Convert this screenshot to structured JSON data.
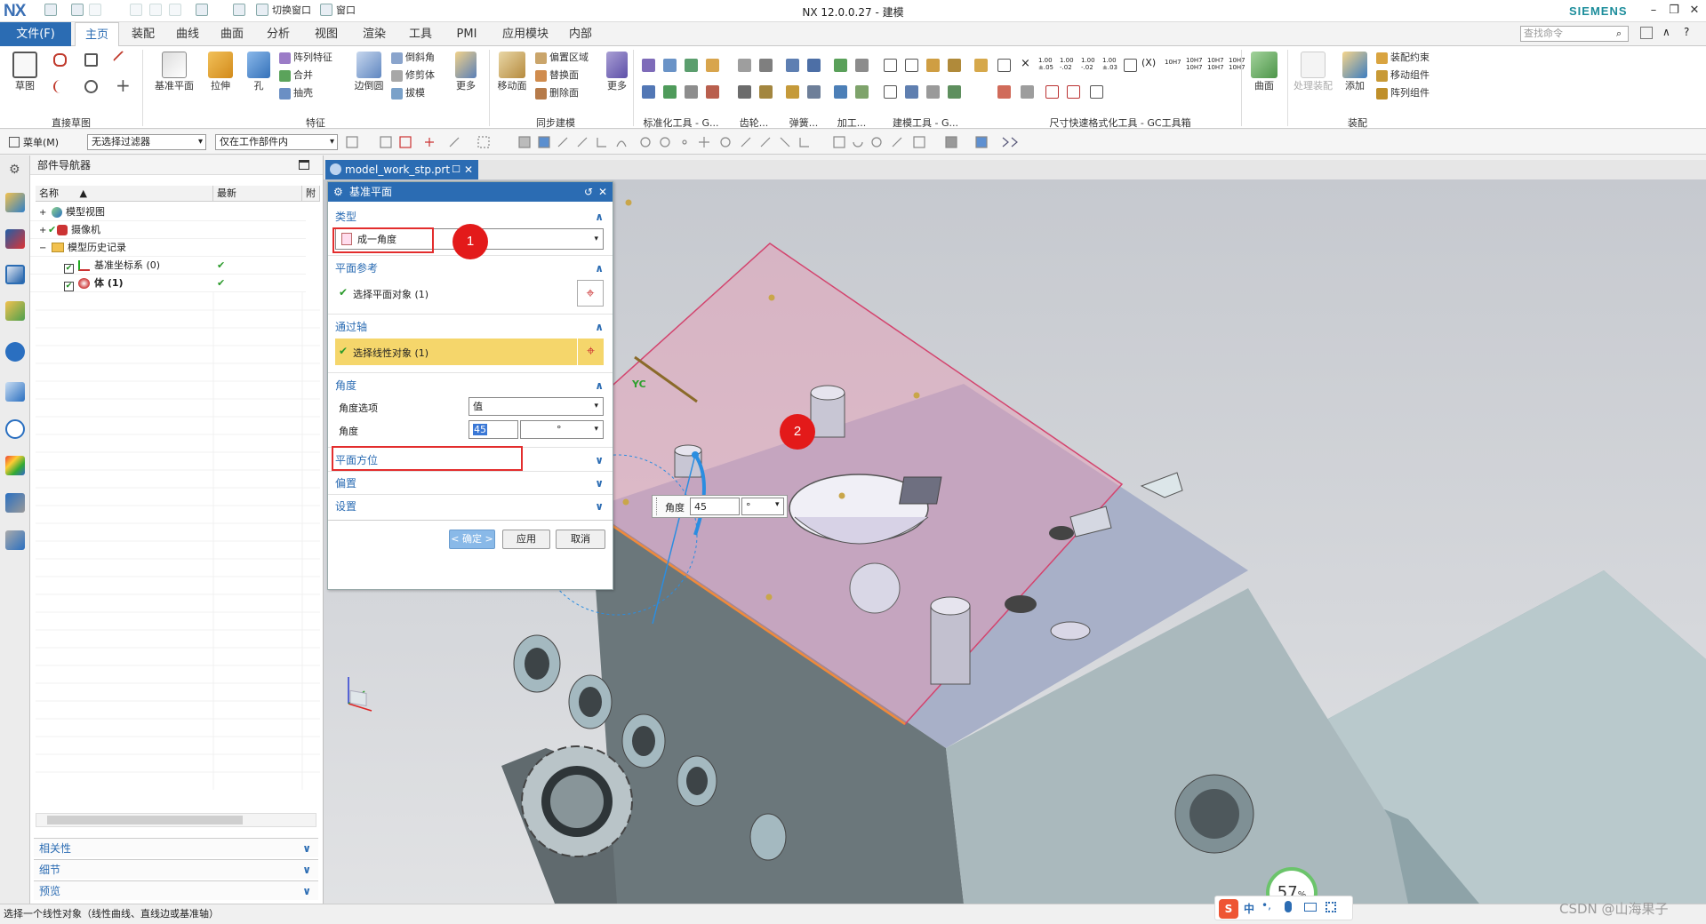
{
  "window": {
    "logo": "NX",
    "title": "NX 12.0.0.27 - 建模",
    "brand": "SIEMENS",
    "quick_access": {
      "switch_window": "切换窗口",
      "window": "窗口"
    },
    "controls": {
      "minimize": "–",
      "restore": "❐",
      "close": "✕"
    }
  },
  "menubar": {
    "file": "文件(F)",
    "tabs": [
      "主页",
      "装配",
      "曲线",
      "曲面",
      "分析",
      "视图",
      "渲染",
      "工具",
      "PMI",
      "应用模块",
      "内部"
    ],
    "active_tab": "主页",
    "search_placeholder": "查找命令"
  },
  "ribbon": {
    "sketch": "草图",
    "sketch_group": "直接草图",
    "datum_plane": "基准平面",
    "extrude": "拉伸",
    "hole": "孔",
    "pattern_feature": "阵列特征",
    "unite": "合并",
    "shell": "抽壳",
    "edge_blend": "边倒圆",
    "chamfer": "倒斜角",
    "trim_body": "修剪体",
    "draft": "拔模",
    "more": "更多",
    "feature_group": "特征",
    "move_face": "移动面",
    "offset_region": "偏置区域",
    "replace_face": "替换面",
    "delete_face": "删除面",
    "sync_group": "同步建模",
    "std_tools": "标准化工具 - G...",
    "gear": "齿轮...",
    "spring": "弹簧...",
    "machining": "加工...",
    "modeling_tools": "建模工具 - G...",
    "dim_format": "尺寸快速格式化工具 - GC工具箱",
    "surface": "曲面",
    "process_assembly": "处理装配",
    "add": "添加",
    "assembly_constraint": "装配约束",
    "move_component": "移动组件",
    "pattern_component": "阵列组件",
    "assembly_group": "装配",
    "tolerance_labels": [
      "1.00\n±.05",
      "1.00\n-.02",
      "1.00\n-.02",
      "1.00\n±.03",
      "10H7",
      "10H7\n10H7",
      "10H7\n10H7",
      "10H7\n10H7"
    ]
  },
  "toolbar": {
    "menu": "菜单(M)",
    "filter": "无选择过滤器",
    "scope": "仅在工作部件内"
  },
  "navigator": {
    "title": "部件导航器",
    "columns": [
      "名称",
      "最新",
      "附"
    ],
    "rows": [
      {
        "label": "模型视图",
        "check": "",
        "latest": ""
      },
      {
        "label": "摄像机",
        "check": "✔",
        "latest": ""
      },
      {
        "label": "模型历史记录",
        "check": "",
        "latest": ""
      },
      {
        "label": "基准坐标系 (0)",
        "check": "✔",
        "latest": "✔"
      },
      {
        "label": "体 (1)",
        "check": "✔",
        "latest": "✔"
      }
    ],
    "accordion": [
      "相关性",
      "细节",
      "预览"
    ]
  },
  "document": {
    "tab": "model_work_stp.prt"
  },
  "dialog": {
    "title": "基准平面",
    "type_section": "类型",
    "type_value": "成一角度",
    "plane_ref_section": "平面参考",
    "plane_ref_value": "选择平面对象 (1)",
    "axis_section": "通过轴",
    "axis_value": "选择线性对象 (1)",
    "angle_section": "角度",
    "angle_option_label": "角度选项",
    "angle_option_value": "值",
    "angle_label": "角度",
    "angle_value": "45",
    "angle_unit": "°",
    "orientation_section": "平面方位",
    "offset_section": "偏置",
    "settings_section": "设置",
    "ok": "< 确定 >",
    "apply": "应用",
    "cancel": "取消"
  },
  "annotations": {
    "badge1": "1",
    "badge2": "2"
  },
  "onscreen_input": {
    "label": "角度",
    "value": "45",
    "unit": "°"
  },
  "triad": {
    "yc": "YC"
  },
  "zoom": {
    "value": "57",
    "unit": "%"
  },
  "status": {
    "prompt": "选择一个线性对象（线性曲线、直线边或基准轴）"
  },
  "ime": {
    "brand": "S",
    "lang": "中",
    "punct": "•,"
  },
  "watermark": "CSDN @山海果子",
  "colors": {
    "accent": "#2b6cb3",
    "highlight": "#f5d66b",
    "annotation": "#e31a1a",
    "plane": "#e89ab4"
  }
}
